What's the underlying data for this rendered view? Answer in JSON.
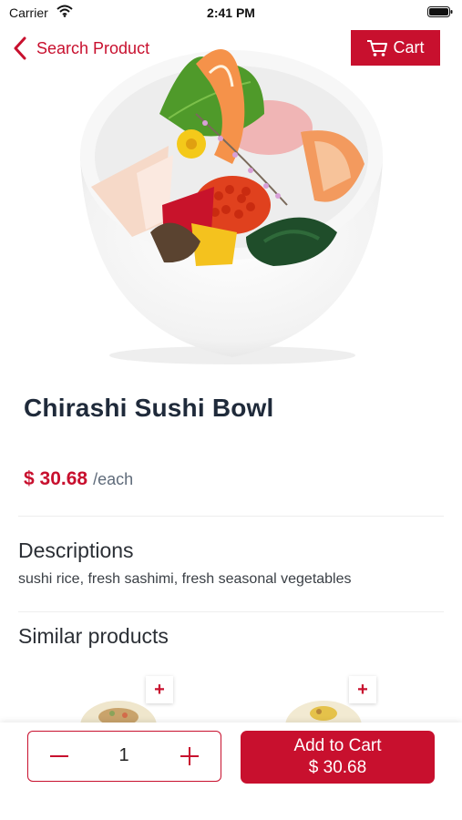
{
  "status_bar": {
    "carrier": "Carrier",
    "time": "2:41 PM"
  },
  "nav": {
    "back_label": "Search Product",
    "cart_label": "Cart"
  },
  "product": {
    "name": "Chirashi Sushi Bowl",
    "price": "$ 30.68",
    "unit": "/each",
    "description_heading": "Descriptions",
    "description": "sushi rice, fresh sashimi, fresh seasonal vegetables"
  },
  "similar": {
    "heading": "Similar products",
    "add_symbol": "+"
  },
  "bottom_bar": {
    "quantity": "1",
    "add_to_cart_label": "Add to Cart",
    "add_to_cart_price": "$ 30.68"
  },
  "colors": {
    "accent": "#c8102e",
    "title": "#1f2a3a"
  },
  "icons": [
    "wifi-icon",
    "battery-icon",
    "chevron-left-icon",
    "cart-icon",
    "minus-icon",
    "plus-icon"
  ]
}
